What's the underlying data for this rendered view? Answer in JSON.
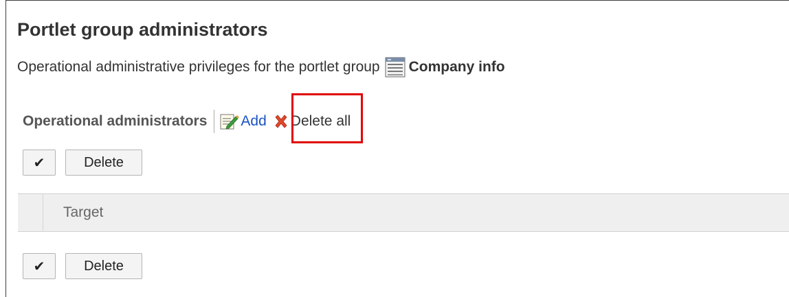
{
  "page": {
    "title": "Portlet group administrators",
    "description_prefix": "Operational administrative privileges for the portlet group",
    "group_name": "Company info",
    "group_icon": "portlet-group-icon"
  },
  "operations": {
    "label": "Operational administrators",
    "add_label": "Add",
    "add_icon": "edit-pencil-icon",
    "delete_all_label": "Delete all",
    "delete_all_icon": "red-x-icon",
    "highlight_color": "#e00000",
    "link_color": "#1a52c6"
  },
  "toolbar_top": {
    "check_glyph": "✔",
    "delete_label": "Delete"
  },
  "table": {
    "columns": [
      "Target"
    ]
  },
  "toolbar_bottom": {
    "check_glyph": "✔",
    "delete_label": "Delete"
  }
}
